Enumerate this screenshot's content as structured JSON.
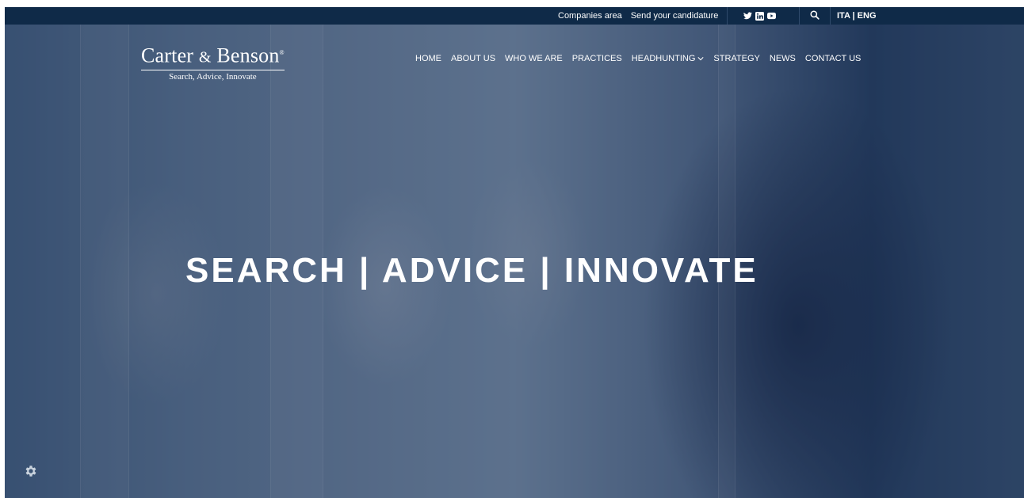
{
  "topbar": {
    "companies_area": "Companies area",
    "send_candidature": "Send your candidature",
    "social_icons": [
      "twitter-icon",
      "linkedin-icon",
      "youtube-icon"
    ],
    "search_icon": "search-icon",
    "language": "ITA | ENG"
  },
  "logo": {
    "name_part1": "Carter",
    "ampersand": "&",
    "name_part2": "Benson",
    "registered": "®",
    "tagline": "Search, Advice, Innovate"
  },
  "nav": {
    "items": [
      "HOME",
      "ABOUT US",
      "WHO WE ARE",
      "PRACTICES",
      "HEADHUNTING",
      "STRATEGY",
      "NEWS",
      "CONTACT US"
    ]
  },
  "hero": {
    "headline": "SEARCH | ADVICE | INNOVATE"
  },
  "colors": {
    "topbar_bg": "#0f2a48",
    "text": "#ffffff"
  }
}
